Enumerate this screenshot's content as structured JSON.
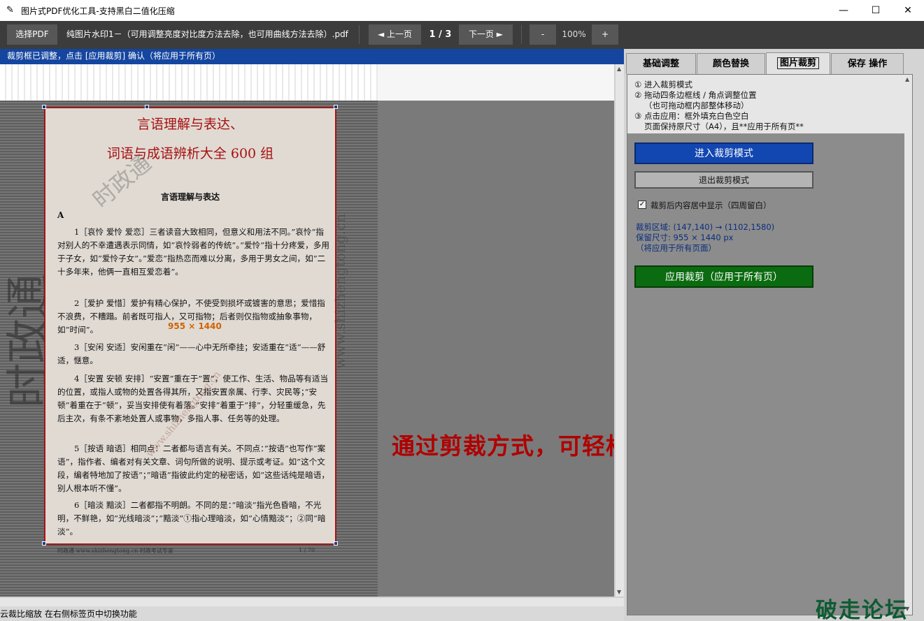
{
  "window": {
    "title": "图片式PDF优化工具-支持黑白二值化压缩",
    "app_icon": "feather-icon",
    "minimize": "—",
    "maximize": "☐",
    "close": "✕"
  },
  "toolbar": {
    "select_pdf": "选择PDF",
    "filename": "纯图片水印1－（可用调整亮度对比度方法去除，也可用曲线方法去除）.pdf",
    "prev": "◄ 上一页",
    "page_indicator": "1 / 3",
    "next": "下一页 ►",
    "zoom_out": "-",
    "zoom": "100%",
    "zoom_in": "+"
  },
  "status_bar": "裁剪框已调整，点击 [应用裁剪] 确认（将应用于所有页）",
  "document": {
    "title_line1": "言语理解与表达、",
    "title_line2": "词语与成语辨析大全 600 组",
    "section": "言语理解与表达",
    "section_letter": "A",
    "paragraphs": [
      "1［哀怜 爱怜 爱恋］三者读音大致相同，但意义和用法不同。”哀怜”指对别人的不幸遭遇表示同情，如”哀怜弱者的传统”。”爱怜”指十分疼爱，多用于子女，如”爱怜子女”。”爱恋”指热恋而难以分离，多用于男女之间，如”二十多年来，他俩一直相互爱恋着”。",
      "2［爱护 爱惜］爱护有精心保护，不使受到损坏或镀害的意思；爱惜指不浪费，不糟蹋。前者既可指人，又可指物；后者则仅指物或抽象事物，如”时间”。",
      "3［安闲 安适］安闲重在”闲”——心中无所牵挂；安适重在”适”——舒适，惬意。",
      "4［安置 安顿 安排］“安置”重在于”置”，使工作、生活、物品等有适当的位置，或指人或物的处置各得其所，又指安置亲属、行李、灾民等；”安顿”着重在于”顿”，妥当安排使有着落。”安排”着重于”排”，分轻重缓急，先后主次，有条不紊地处置人或事物，多指人事、任务等的处理。",
      "5［按语 暗语］相同点：二者都与语言有关。不同点：”按语”也写作”案语”，指作者、编者对有关文章、词句所做的说明、提示或考证。如”这个文段，编者特地加了按语”；”暗语”指彼此约定的秘密话，如”这些话纯是暗语，别人根本听不懂”。",
      "6［暗淡 黯淡］二者都指不明朗。不同的是：”暗淡”指光色昏暗，不光明，不鲜艳，如”光线暗淡”；”黯淡”①指心理暗淡，如”心情黯淡”；②同”暗淡”。"
    ],
    "footer_left": "时政通 www.shizhengtong.cn 时政考试专家",
    "footer_right": "1 / 70",
    "crop_dimension": "955 × 1440"
  },
  "watermarks": {
    "big_vertical": "时政通",
    "small_diagonal": "时政通",
    "url_vertical": "www.shizhengtong.cn",
    "url_diagonal": "www.shizhengtong.cn"
  },
  "overlay_caption": "通过剪裁方式，可轻松去除PDF页眉页脚水印",
  "bottom_status": "云裁比缩放  在右侧标签页中切换功能",
  "tabs": [
    {
      "label": "基础调整"
    },
    {
      "label": "颜色替换"
    },
    {
      "label": "图片裁剪"
    },
    {
      "label": "保存 操作"
    }
  ],
  "crop_panel": {
    "instructions": [
      "① 进入裁剪模式",
      "② 拖动四条边框线 / 角点调整位置",
      "（也可拖动框内部整体移动）",
      "③ 点击应用：框外填充白色空白",
      "页面保持原尺寸（A4），且**应用于所有页**"
    ],
    "enter_button": "进入裁剪模式",
    "exit_button": "退出裁剪模式",
    "center_checkbox": "裁剪后内容居中显示（四周留白）",
    "center_checked": true,
    "crop_area": "裁剪区域: (147,140) → (1102,1580)",
    "keep_size": "保留尺寸: 955 × 1440 px",
    "apply_note": "（将应用于所有页面）",
    "apply_button": "应用裁剪（应用于所有页）"
  },
  "logo_text": "破走论坛",
  "colors": {
    "status_blue": "#1446a0",
    "enter_button_blue": "#1246b0",
    "apply_button_green": "#0b6b10",
    "caption_red": "#b00000",
    "crop_border_red": "#a31515"
  }
}
